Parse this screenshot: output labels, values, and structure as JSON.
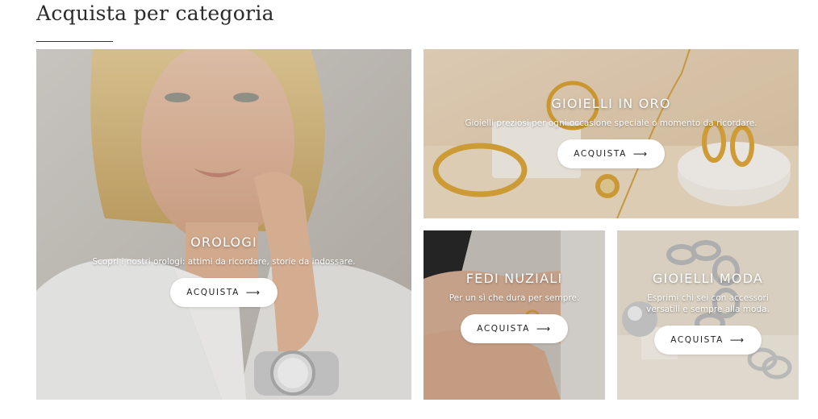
{
  "section": {
    "title": "Acquista per categoria"
  },
  "cards": [
    {
      "title": "OROLOGI",
      "description": "Scopri i nostri orologi: attimi da ricordare, storie da indossare.",
      "button_label": "ACQUISTA",
      "arrow_icon": "arrow-right-icon"
    },
    {
      "title": "GIOIELLI IN ORO",
      "description": "Gioielli preziosi per ogni occasione speciale o momento da ricordare.",
      "button_label": "ACQUISTA",
      "arrow_icon": "arrow-right-icon"
    },
    {
      "title": "FEDI NUZIALI",
      "description": "Per un sì che dura per sempre.",
      "button_label": "ACQUISTA",
      "arrow_icon": "arrow-right-icon"
    },
    {
      "title": "GIOIELLI MODA",
      "description": "Esprimi chi sei con accessori versatili e sempre alla moda.",
      "button_label": "ACQUISTA",
      "arrow_icon": "arrow-right-icon"
    }
  ],
  "colors": {
    "text": "#2b2b2b",
    "button_bg": "#ffffff",
    "card_text": "#ffffff"
  }
}
